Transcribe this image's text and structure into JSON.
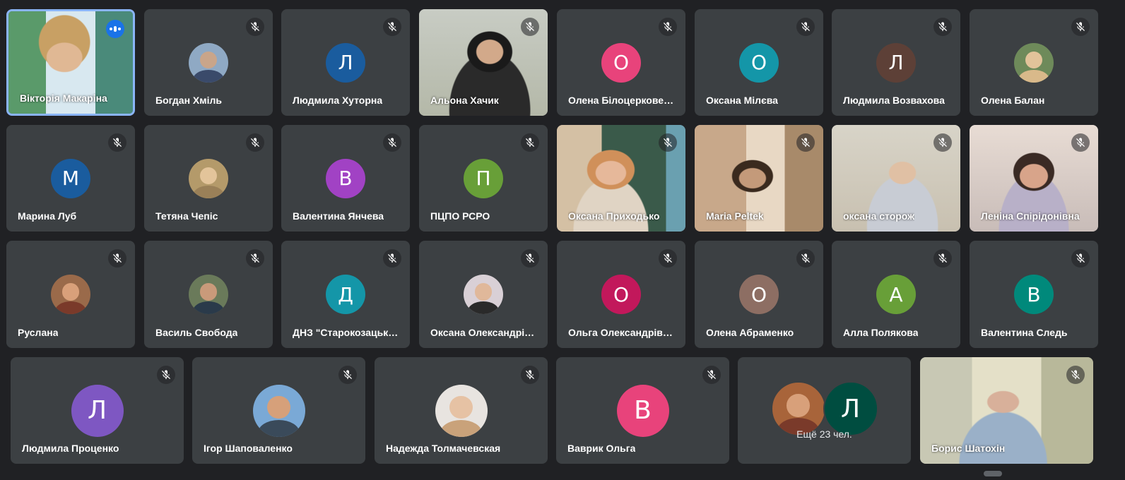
{
  "participants": [
    {
      "name": "Вікторія Макаріна",
      "type": "video",
      "active": true
    },
    {
      "name": "Богдан Хміль",
      "type": "photo",
      "photo_bg": "#8fa9c4",
      "photo_face": "#c9a58a",
      "photo_body": "#3a4a6a"
    },
    {
      "name": "Людмила Хуторна",
      "type": "letter",
      "letter": "Л",
      "color": "#1a5c9e"
    },
    {
      "name": "Альона Хачик",
      "type": "video"
    },
    {
      "name": "Олена Білоцерковець",
      "type": "letter",
      "letter": "О",
      "color": "#e8437b"
    },
    {
      "name": "Оксана Мілєва",
      "type": "letter",
      "letter": "О",
      "color": "#1496a8"
    },
    {
      "name": "Людмила Возвахова",
      "type": "letter",
      "letter": "Л",
      "color": "#5d4037"
    },
    {
      "name": "Олена Балан",
      "type": "photo",
      "photo_bg": "#6e8a5a",
      "photo_face": "#e2c39a",
      "photo_body": "#d9b98a"
    },
    {
      "name": "Марина Луб",
      "type": "letter",
      "letter": "М",
      "color": "#1a5c9e"
    },
    {
      "name": "Тетяна Чепіс",
      "type": "photo",
      "photo_bg": "#b49a6a",
      "photo_face": "#e3c49a",
      "photo_body": "#9a8058"
    },
    {
      "name": "Валентина Янчева",
      "type": "letter",
      "letter": "В",
      "color": "#a142c4"
    },
    {
      "name": "ПЦПО РСРО",
      "type": "letter",
      "letter": "П",
      "color": "#689f38"
    },
    {
      "name": "Оксана Приходько",
      "type": "video"
    },
    {
      "name": "Maria Peltek",
      "type": "video"
    },
    {
      "name": "оксана сторож",
      "type": "video"
    },
    {
      "name": "Леніна Спірідонівна",
      "type": "video"
    },
    {
      "name": "Руслана",
      "type": "photo",
      "photo_bg": "#9a6a4a",
      "photo_face": "#d9a07a",
      "photo_body": "#7a3a2a"
    },
    {
      "name": "Василь Свобода",
      "type": "photo",
      "photo_bg": "#6a7a5a",
      "photo_face": "#c99a7a",
      "photo_body": "#2a3a4a"
    },
    {
      "name": "ДНЗ \"Старокозацький\"",
      "type": "letter",
      "letter": "Д",
      "color": "#1496a8"
    },
    {
      "name": "Оксана Олександрівна",
      "type": "photo",
      "photo_bg": "#d9d0d6",
      "photo_face": "#e0b89a",
      "photo_body": "#2a2a2a"
    },
    {
      "name": "Ольга Олександрівна",
      "type": "letter",
      "letter": "О",
      "color": "#c2185b"
    },
    {
      "name": "Олена Абраменко",
      "type": "letter",
      "letter": "О",
      "color": "#8d6e63"
    },
    {
      "name": "Алла Полякова",
      "type": "letter",
      "letter": "А",
      "color": "#689f38"
    },
    {
      "name": "Валентина Следь",
      "type": "letter",
      "letter": "В",
      "color": "#00897b"
    },
    {
      "name": "Людмила Проценко",
      "type": "letter",
      "letter": "Л",
      "color": "#7e57c2"
    },
    {
      "name": "Ігор Шаповаленко",
      "type": "photo",
      "photo_bg": "#7aa9d6",
      "photo_face": "#d6a07a",
      "photo_body": "#3a4a5a"
    },
    {
      "name": "Надежда Толмачевская",
      "type": "photo",
      "photo_bg": "#e8e4e0",
      "photo_face": "#e6c2a4",
      "photo_body": "#c9a27a"
    },
    {
      "name": "Ваврик Ольга",
      "type": "letter",
      "letter": "В",
      "color": "#e8437b"
    },
    {
      "type": "more",
      "more_text": "Ещё 23 чел.",
      "letter": "Л",
      "color": "#004d40"
    },
    {
      "name": "Борис Шатохін",
      "type": "video"
    }
  ]
}
